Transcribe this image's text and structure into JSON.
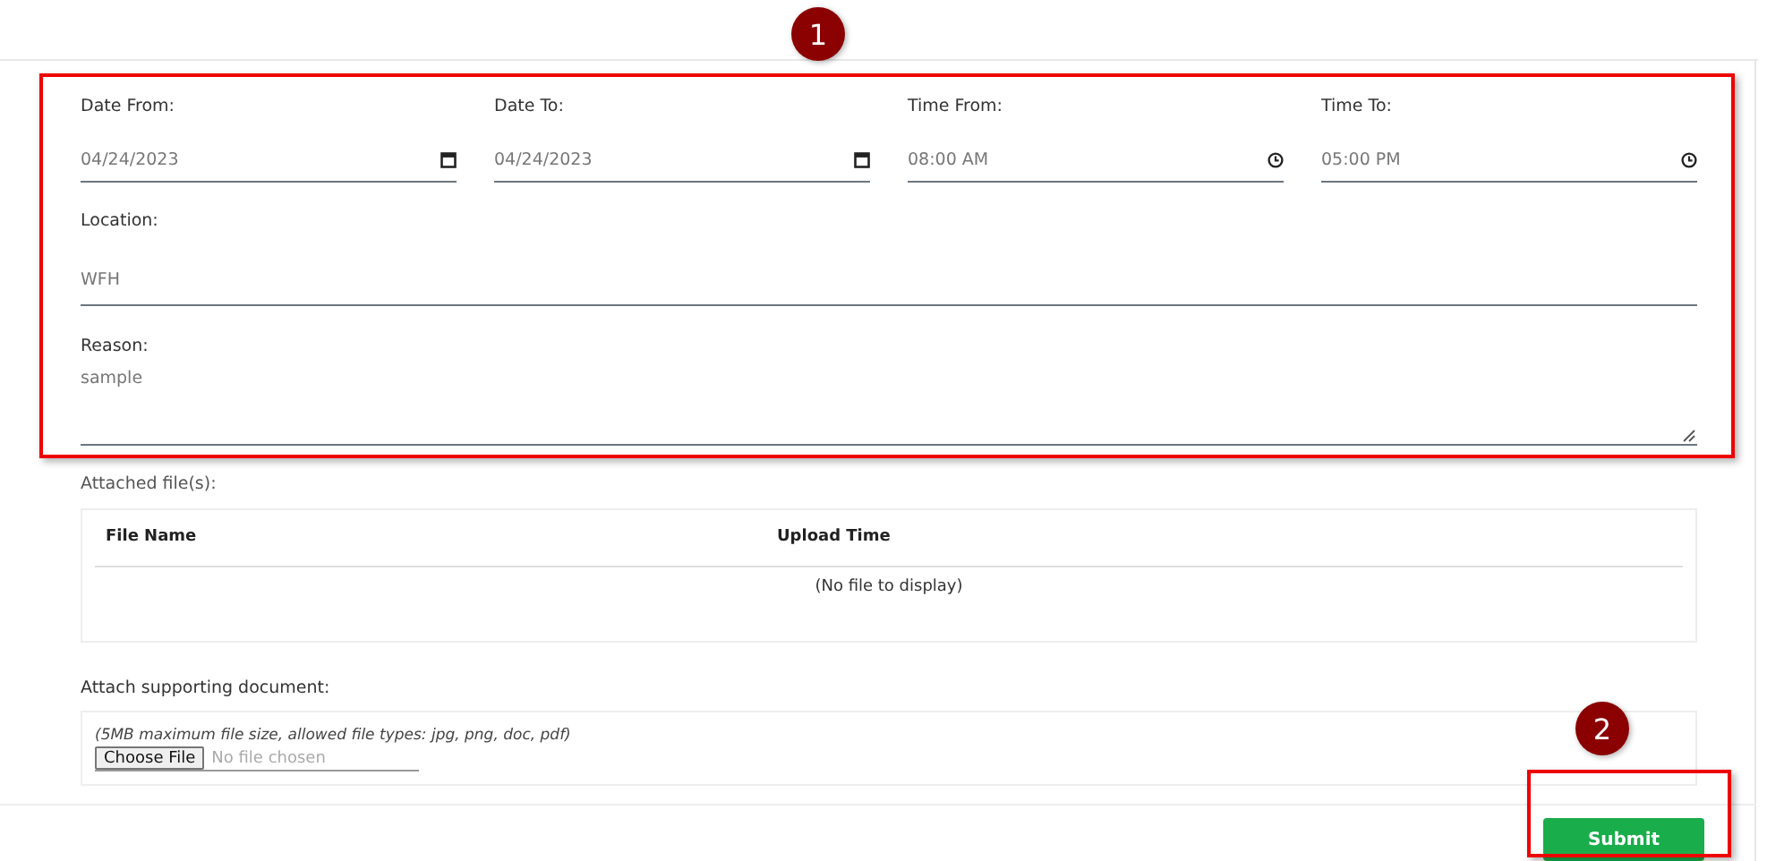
{
  "fields_row": [
    {
      "label": "Date From:",
      "value": "04/24/2023",
      "kind": "date"
    },
    {
      "label": "Date To:",
      "value": "04/24/2023",
      "kind": "date"
    },
    {
      "label": "Time From:",
      "value": "08:00 AM",
      "kind": "time"
    },
    {
      "label": "Time To:",
      "value": "05:00 PM",
      "kind": "time"
    }
  ],
  "location": {
    "label": "Location:",
    "value": "WFH"
  },
  "reason": {
    "label": "Reason:",
    "value": "sample"
  },
  "attached": {
    "label": "Attached file(s):",
    "columns": [
      "File Name",
      "Upload Time"
    ],
    "empty_text": "(No file to display)"
  },
  "attach": {
    "label": "Attach supporting document:",
    "hint": "(5MB maximum file size, allowed file types: jpg, png, doc, pdf)",
    "button": "Choose File",
    "status": "No file chosen"
  },
  "submit": "Submit",
  "annotations": [
    {
      "number": "1"
    },
    {
      "number": "2"
    }
  ]
}
